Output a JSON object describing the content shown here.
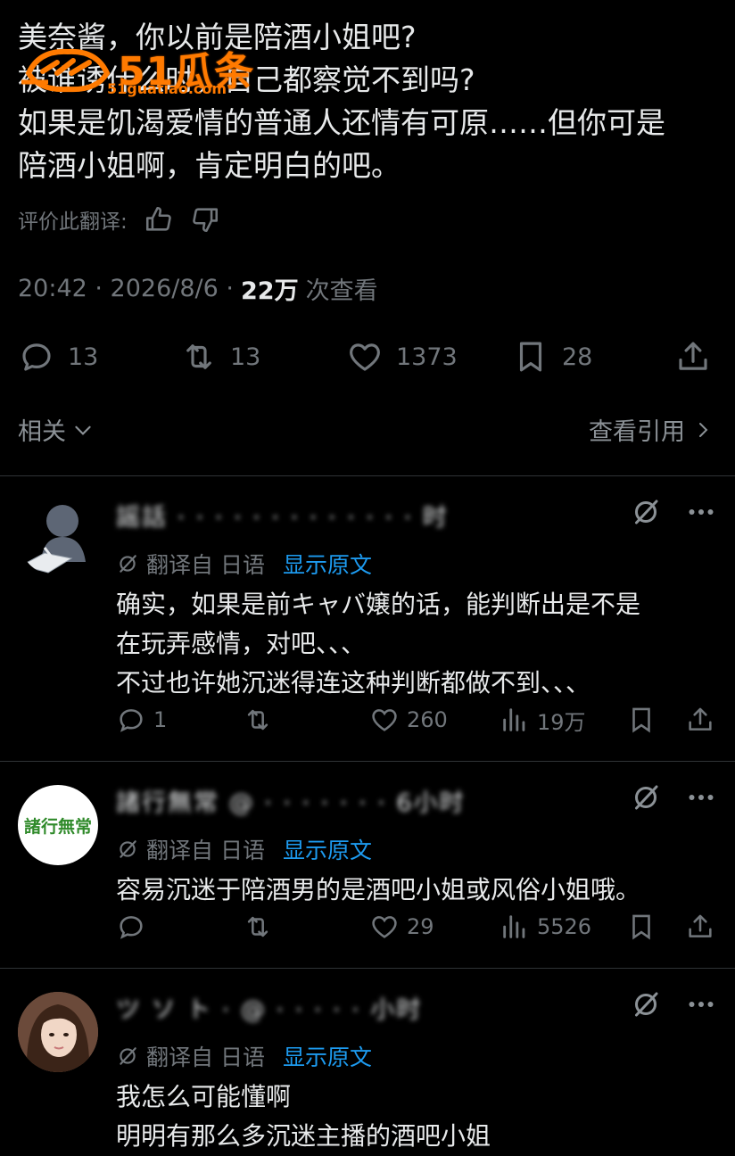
{
  "post": {
    "text": "美奈酱，你以前是陪酒小姐吧?\n被谁诱什么时，自己都察觉不到吗?\n如果是饥渴爱情的普通人还情有可原……但你可是\n陪酒小姐啊，肯定明白的吧。",
    "rate_label": "评价此翻译:",
    "time": "20:42 · 2026/8/6 ·",
    "views": "22万",
    "views_suffix": "次查看",
    "replies": "13",
    "reposts": "13",
    "likes": "1373",
    "bookmarks": "28",
    "related_label": "相关",
    "quotes_label": "查看引用"
  },
  "watermark": {
    "main": "51瓜条",
    "sub": "51guatiao.com"
  },
  "replies": [
    {
      "name": "謡話 · · · · · · · · · · · · · 时",
      "translate_label": "翻译自 日语",
      "show_original": "显示原文",
      "body": "确实，如果是前キャバ嬢的话，能判断出是不是\n在玩弄感情，对吧、、、\n不过也许她沉迷得连这种判断都做不到、、、",
      "replies": "1",
      "reposts": "",
      "likes": "260",
      "views": "19万"
    },
    {
      "name": "諸行無常 @ · · · · · · · 6小时",
      "avatar_text": "諸行無常",
      "translate_label": "翻译自 日语",
      "show_original": "显示原文",
      "body": "容易沉迷于陪酒男的是酒吧小姐或风俗小姐哦。",
      "replies": "",
      "reposts": "",
      "likes": "29",
      "views": "5526"
    },
    {
      "name": "ツ ソ ト · @ · · · · · 小时",
      "translate_label": "翻译自 日语",
      "show_original": "显示原文",
      "body": "我怎么可能懂啊\n明明有那么多沉迷主播的酒吧小姐",
      "replies": "",
      "reposts": "",
      "likes": "",
      "views": ""
    }
  ],
  "colors": {
    "background": "#000000",
    "text": "#e7e9ea",
    "muted": "#71767b",
    "link": "#1d9bf0",
    "divider": "#2f3336",
    "watermark": "#ff7a00"
  }
}
